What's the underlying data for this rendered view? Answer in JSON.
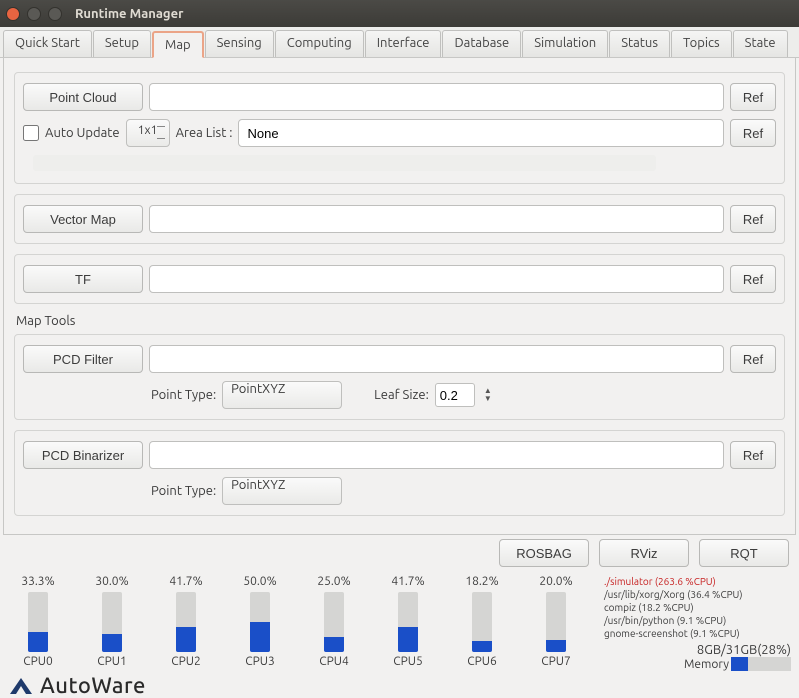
{
  "window": {
    "title": "Runtime Manager"
  },
  "tabs": [
    "Quick Start",
    "Setup",
    "Map",
    "Sensing",
    "Computing",
    "Interface",
    "Database",
    "Simulation",
    "Status",
    "Topics",
    "State"
  ],
  "active_tab": "Map",
  "map": {
    "point_cloud_btn": "Point Cloud",
    "point_cloud_path": "",
    "ref": "Ref",
    "auto_update_label": "Auto Update",
    "grid": "1x1",
    "area_list_label": "Area List :",
    "area_list_value": "None",
    "vector_map_btn": "Vector Map",
    "vector_map_path": "",
    "tf_btn": "TF",
    "tf_path": "",
    "map_tools_label": "Map Tools",
    "pcd_filter_btn": "PCD Filter",
    "pcd_filter_path": "",
    "point_type_label": "Point Type:",
    "point_type_value": "PointXYZ",
    "leaf_size_label": "Leaf Size:",
    "leaf_size_value": "0.2",
    "pcd_binarizer_btn": "PCD Binarizer",
    "pcd_binarizer_path": ""
  },
  "bottom": {
    "rosbag": "ROSBAG",
    "rviz": "RViz",
    "rqt": "RQT"
  },
  "cpus": [
    {
      "name": "CPU0",
      "pct": 33.3
    },
    {
      "name": "CPU1",
      "pct": 30.0
    },
    {
      "name": "CPU2",
      "pct": 41.7
    },
    {
      "name": "CPU3",
      "pct": 50.0
    },
    {
      "name": "CPU4",
      "pct": 25.0
    },
    {
      "name": "CPU5",
      "pct": 41.7
    },
    {
      "name": "CPU6",
      "pct": 18.2
    },
    {
      "name": "CPU7",
      "pct": 20.0
    }
  ],
  "procs": [
    {
      "text": "./simulator (263.6 %CPU)",
      "hot": true
    },
    {
      "text": "/usr/lib/xorg/Xorg (36.4 %CPU)",
      "hot": false
    },
    {
      "text": "compiz (18.2 %CPU)",
      "hot": false
    },
    {
      "text": "/usr/bin/python (9.1 %CPU)",
      "hot": false
    },
    {
      "text": "gnome-screenshot (9.1 %CPU)",
      "hot": false
    }
  ],
  "memory": {
    "summary": "8GB/31GB(28%)",
    "label": "Memory",
    "pct": 28
  },
  "logo": "AutoWare"
}
